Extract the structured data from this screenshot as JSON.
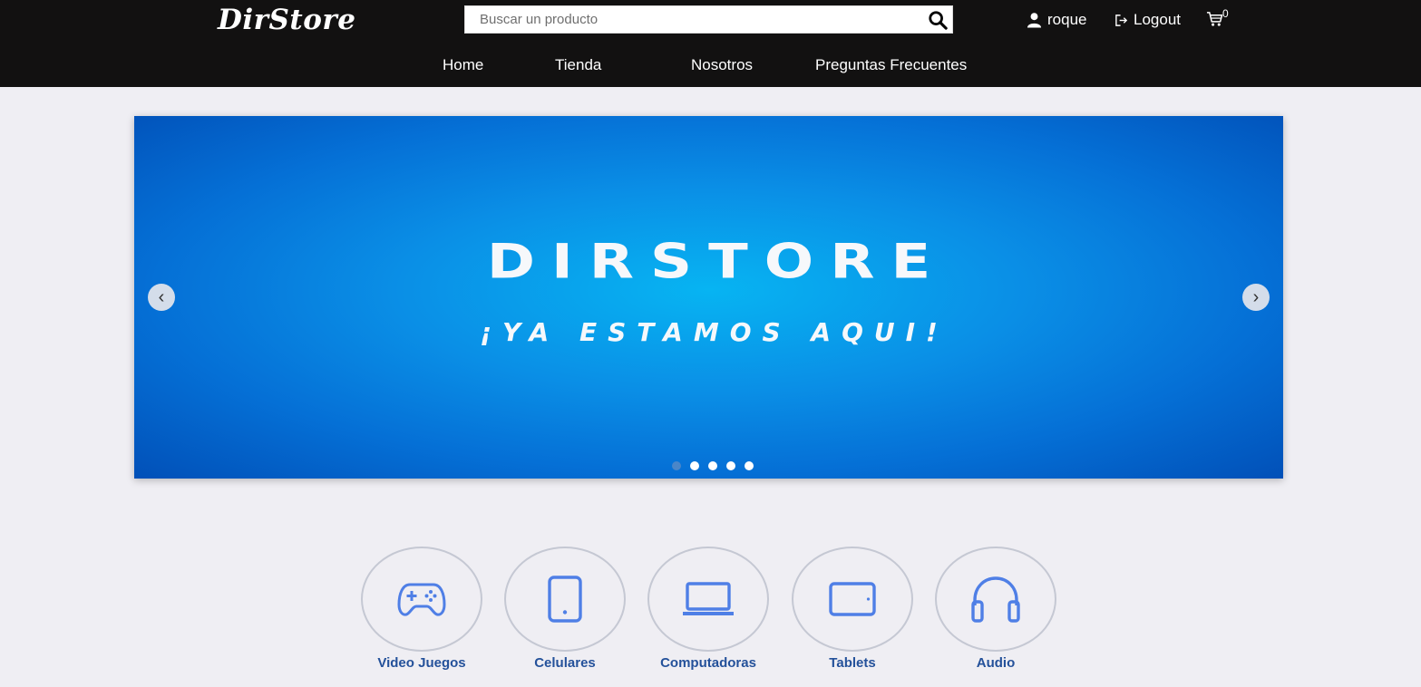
{
  "header": {
    "logo": "DirStore",
    "search": {
      "placeholder": "Buscar un producto",
      "value": ""
    },
    "user": "roque",
    "logout": "Logout",
    "cart_count": "0",
    "nav": [
      "Home",
      "Tienda",
      "Nosotros",
      "Preguntas Frecuentes"
    ]
  },
  "carousel": {
    "title": "DIRSTORE",
    "subtitle": "¡YA ESTAMOS AQUI!",
    "prev": "‹",
    "next": "›",
    "slides": 5,
    "active_slide": 1
  },
  "categories": [
    {
      "label": "Video Juegos",
      "icon": "gamepad-icon"
    },
    {
      "label": "Celulares",
      "icon": "phone-icon"
    },
    {
      "label": "Computadoras",
      "icon": "laptop-icon"
    },
    {
      "label": "Tablets",
      "icon": "tablet-icon"
    },
    {
      "label": "Audio",
      "icon": "headphones-icon"
    }
  ],
  "colors": {
    "header_bg": "#121111",
    "page_bg": "#efeef3",
    "icon_blue": "#4f7fe6",
    "category_label": "#24519a"
  }
}
